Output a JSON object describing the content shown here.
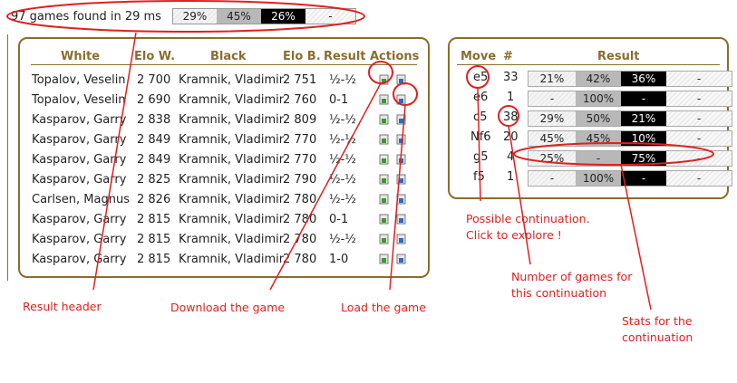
{
  "summary": {
    "text": "97 games found in 29 ms",
    "stats": [
      "29%",
      "45%",
      "26%",
      "-"
    ]
  },
  "games_table": {
    "headers": [
      "White",
      "Elo W.",
      "Black",
      "Elo B.",
      "Result",
      "Actions"
    ],
    "rows": [
      {
        "white": "Topalov, Veselin",
        "elo_w": "2 700",
        "black": "Kramnik, Vladimir",
        "elo_b": "2 751",
        "result": "½-½"
      },
      {
        "white": "Topalov, Veselin",
        "elo_w": "2 690",
        "black": "Kramnik, Vladimir",
        "elo_b": "2 760",
        "result": "0-1"
      },
      {
        "white": "Kasparov, Garry",
        "elo_w": "2 838",
        "black": "Kramnik, Vladimir",
        "elo_b": "2 809",
        "result": "½-½"
      },
      {
        "white": "Kasparov, Garry",
        "elo_w": "2 849",
        "black": "Kramnik, Vladimir",
        "elo_b": "2 770",
        "result": "½-½"
      },
      {
        "white": "Kasparov, Garry",
        "elo_w": "2 849",
        "black": "Kramnik, Vladimir",
        "elo_b": "2 770",
        "result": "½-½"
      },
      {
        "white": "Kasparov, Garry",
        "elo_w": "2 825",
        "black": "Kramnik, Vladimir",
        "elo_b": "2 790",
        "result": "½-½"
      },
      {
        "white": "Carlsen, Magnus",
        "elo_w": "2 826",
        "black": "Kramnik, Vladimir",
        "elo_b": "2 780",
        "result": "½-½"
      },
      {
        "white": "Kasparov, Garry",
        "elo_w": "2 815",
        "black": "Kramnik, Vladimir",
        "elo_b": "2 780",
        "result": "0-1"
      },
      {
        "white": "Kasparov, Garry",
        "elo_w": "2 815",
        "black": "Kramnik, Vladimir",
        "elo_b": "2 780",
        "result": "½-½"
      },
      {
        "white": "Kasparov, Garry",
        "elo_w": "2 815",
        "black": "Kramnik, Vladimir",
        "elo_b": "2 780",
        "result": "1-0"
      }
    ],
    "download_icon": "download-icon",
    "load_icon": "load-game-icon"
  },
  "moves_table": {
    "headers": [
      "Move",
      "#",
      "Result"
    ],
    "rows": [
      {
        "move": "e5",
        "count": "33",
        "stats": [
          "21%",
          "42%",
          "36%",
          "-"
        ]
      },
      {
        "move": "e6",
        "count": "1",
        "stats": [
          "-",
          "100%",
          "-",
          "-"
        ]
      },
      {
        "move": "c5",
        "count": "38",
        "stats": [
          "29%",
          "50%",
          "21%",
          "-"
        ]
      },
      {
        "move": "Nf6",
        "count": "20",
        "stats": [
          "45%",
          "45%",
          "10%",
          "-"
        ]
      },
      {
        "move": "g5",
        "count": "4",
        "stats": [
          "25%",
          "-",
          "75%",
          "-"
        ]
      },
      {
        "move": "f5",
        "count": "1",
        "stats": [
          "-",
          "100%",
          "-",
          "-"
        ]
      }
    ]
  },
  "annotations": {
    "continuation": "Possible continuation.\nClick to explore !",
    "num_games": "Number of games for\nthis continuation",
    "stats": "Stats for the\ncontinuation",
    "result_header": "Result header",
    "download": "Download the game",
    "load": "Load the game"
  },
  "colors": {
    "accent": "#8a6d2f",
    "annotation": "#e02020",
    "white_win": "#f4f4f4",
    "draw": "#b8b8b8",
    "black_win": "#000000"
  }
}
